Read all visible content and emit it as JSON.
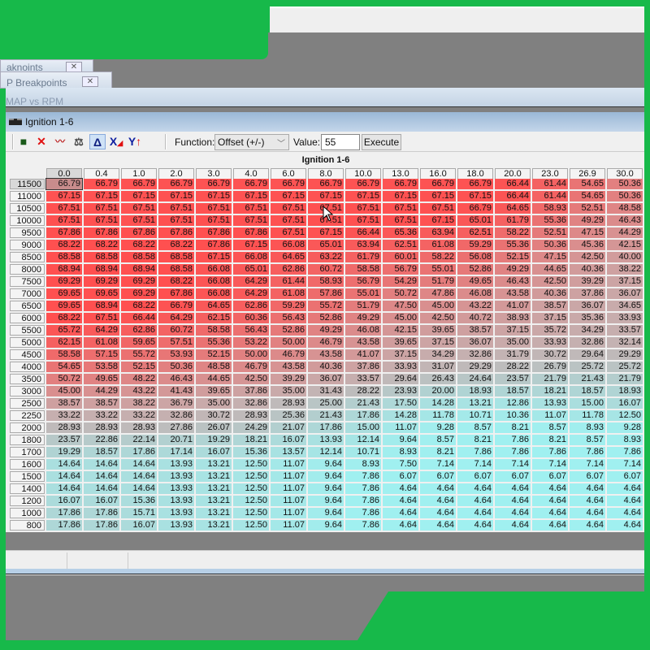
{
  "tabs": [
    {
      "label": "aknoints"
    },
    {
      "label": "P Breakpoints"
    }
  ],
  "map_window": {
    "title": "MAP vs RPM"
  },
  "window": {
    "title": "Ignition 1-6"
  },
  "toolbar": {
    "icons": [
      "save-icon",
      "delete-icon",
      "graph-icon",
      "balance-icon",
      "delta-icon",
      "x-axis-icon",
      "y-axis-icon"
    ],
    "function_label": "Function:",
    "function_value": "Offset (+/-)",
    "value_label": "Value:",
    "value": "55",
    "execute_label": "Execute"
  },
  "table": {
    "title": "Ignition 1-6",
    "columns": [
      "0.0",
      "0.4",
      "1.0",
      "2.0",
      "3.0",
      "4.0",
      "6.0",
      "8.0",
      "10.0",
      "13.0",
      "16.0",
      "18.0",
      "20.0",
      "23.0",
      "26.9",
      "30.0"
    ],
    "selected_cell": {
      "row": "11500",
      "column": "0.0"
    },
    "rows": [
      {
        "rpm": "11500",
        "values": [
          "66.79",
          "66.79",
          "66.79",
          "66.79",
          "66.79",
          "66.79",
          "66.79",
          "66.79",
          "66.79",
          "66.79",
          "66.79",
          "66.79",
          "66.44",
          "61.44",
          "54.65",
          "50.36"
        ]
      },
      {
        "rpm": "11000",
        "values": [
          "67.15",
          "67.15",
          "67.15",
          "67.15",
          "67.15",
          "67.15",
          "67.15",
          "67.15",
          "67.15",
          "67.15",
          "67.15",
          "67.15",
          "66.44",
          "61.44",
          "54.65",
          "50.36"
        ]
      },
      {
        "rpm": "10500",
        "values": [
          "67.51",
          "67.51",
          "67.51",
          "67.51",
          "67.51",
          "67.51",
          "67.51",
          "67.51",
          "67.51",
          "67.51",
          "67.51",
          "66.79",
          "64.65",
          "58.93",
          "52.51",
          "48.58"
        ]
      },
      {
        "rpm": "10000",
        "values": [
          "67.51",
          "67.51",
          "67.51",
          "67.51",
          "67.51",
          "67.51",
          "67.51",
          "67.51",
          "67.51",
          "67.51",
          "67.15",
          "65.01",
          "61.79",
          "55.36",
          "49.29",
          "46.43"
        ]
      },
      {
        "rpm": "9500",
        "values": [
          "67.86",
          "67.86",
          "67.86",
          "67.86",
          "67.86",
          "67.86",
          "67.51",
          "67.15",
          "66.44",
          "65.36",
          "63.94",
          "62.51",
          "58.22",
          "52.51",
          "47.15",
          "44.29"
        ]
      },
      {
        "rpm": "9000",
        "values": [
          "68.22",
          "68.22",
          "68.22",
          "68.22",
          "67.86",
          "67.15",
          "66.08",
          "65.01",
          "63.94",
          "62.51",
          "61.08",
          "59.29",
          "55.36",
          "50.36",
          "45.36",
          "42.15"
        ]
      },
      {
        "rpm": "8500",
        "values": [
          "68.58",
          "68.58",
          "68.58",
          "68.58",
          "67.15",
          "66.08",
          "64.65",
          "63.22",
          "61.79",
          "60.01",
          "58.22",
          "56.08",
          "52.15",
          "47.15",
          "42.50",
          "40.00"
        ]
      },
      {
        "rpm": "8000",
        "values": [
          "68.94",
          "68.94",
          "68.94",
          "68.58",
          "66.08",
          "65.01",
          "62.86",
          "60.72",
          "58.58",
          "56.79",
          "55.01",
          "52.86",
          "49.29",
          "44.65",
          "40.36",
          "38.22"
        ]
      },
      {
        "rpm": "7500",
        "values": [
          "69.29",
          "69.29",
          "69.29",
          "68.22",
          "66.08",
          "64.29",
          "61.44",
          "58.93",
          "56.79",
          "54.29",
          "51.79",
          "49.65",
          "46.43",
          "42.50",
          "39.29",
          "37.15"
        ]
      },
      {
        "rpm": "7000",
        "values": [
          "69.65",
          "69.65",
          "69.29",
          "67.86",
          "66.08",
          "64.29",
          "61.08",
          "57.86",
          "55.01",
          "50.72",
          "47.86",
          "46.08",
          "43.58",
          "40.36",
          "37.86",
          "36.07"
        ]
      },
      {
        "rpm": "6500",
        "values": [
          "69.65",
          "68.94",
          "68.22",
          "66.79",
          "64.65",
          "62.86",
          "59.29",
          "55.72",
          "51.79",
          "47.50",
          "45.00",
          "43.22",
          "41.07",
          "38.57",
          "36.07",
          "34.65"
        ]
      },
      {
        "rpm": "6000",
        "values": [
          "68.22",
          "67.51",
          "66.44",
          "64.29",
          "62.15",
          "60.36",
          "56.43",
          "52.86",
          "49.29",
          "45.00",
          "42.50",
          "40.72",
          "38.93",
          "37.15",
          "35.36",
          "33.93"
        ]
      },
      {
        "rpm": "5500",
        "values": [
          "65.72",
          "64.29",
          "62.86",
          "60.72",
          "58.58",
          "56.43",
          "52.86",
          "49.29",
          "46.08",
          "42.15",
          "39.65",
          "38.57",
          "37.15",
          "35.72",
          "34.29",
          "33.57"
        ]
      },
      {
        "rpm": "5000",
        "values": [
          "62.15",
          "61.08",
          "59.65",
          "57.51",
          "55.36",
          "53.22",
          "50.00",
          "46.79",
          "43.58",
          "39.65",
          "37.15",
          "36.07",
          "35.00",
          "33.93",
          "32.86",
          "32.14"
        ]
      },
      {
        "rpm": "4500",
        "values": [
          "58.58",
          "57.15",
          "55.72",
          "53.93",
          "52.15",
          "50.00",
          "46.79",
          "43.58",
          "41.07",
          "37.15",
          "34.29",
          "32.86",
          "31.79",
          "30.72",
          "29.64",
          "29.29"
        ]
      },
      {
        "rpm": "4000",
        "values": [
          "54.65",
          "53.58",
          "52.15",
          "50.36",
          "48.58",
          "46.79",
          "43.58",
          "40.36",
          "37.86",
          "33.93",
          "31.07",
          "29.29",
          "28.22",
          "26.79",
          "25.72",
          "25.72"
        ]
      },
      {
        "rpm": "3500",
        "values": [
          "50.72",
          "49.65",
          "48.22",
          "46.43",
          "44.65",
          "42.50",
          "39.29",
          "36.07",
          "33.57",
          "29.64",
          "26.43",
          "24.64",
          "23.57",
          "21.79",
          "21.43",
          "21.79"
        ]
      },
      {
        "rpm": "3000",
        "values": [
          "45.00",
          "44.29",
          "43.22",
          "41.43",
          "39.65",
          "37.86",
          "35.00",
          "31.43",
          "28.22",
          "23.93",
          "20.00",
          "18.93",
          "18.57",
          "18.21",
          "18.57",
          "18.93"
        ]
      },
      {
        "rpm": "2500",
        "values": [
          "38.57",
          "38.57",
          "38.22",
          "36.79",
          "35.00",
          "32.86",
          "28.93",
          "25.00",
          "21.43",
          "17.50",
          "14.28",
          "13.21",
          "12.86",
          "13.93",
          "15.00",
          "16.07"
        ]
      },
      {
        "rpm": "2250",
        "values": [
          "33.22",
          "33.22",
          "33.22",
          "32.86",
          "30.72",
          "28.93",
          "25.36",
          "21.43",
          "17.86",
          "14.28",
          "11.78",
          "10.71",
          "10.36",
          "11.07",
          "11.78",
          "12.50"
        ]
      },
      {
        "rpm": "2000",
        "values": [
          "28.93",
          "28.93",
          "28.93",
          "27.86",
          "26.07",
          "24.29",
          "21.07",
          "17.86",
          "15.00",
          "11.07",
          "9.28",
          "8.57",
          "8.21",
          "8.57",
          "8.93",
          "9.28"
        ]
      },
      {
        "rpm": "1800",
        "values": [
          "23.57",
          "22.86",
          "22.14",
          "20.71",
          "19.29",
          "18.21",
          "16.07",
          "13.93",
          "12.14",
          "9.64",
          "8.57",
          "8.21",
          "7.86",
          "8.21",
          "8.57",
          "8.93"
        ]
      },
      {
        "rpm": "1700",
        "values": [
          "19.29",
          "18.57",
          "17.86",
          "17.14",
          "16.07",
          "15.36",
          "13.57",
          "12.14",
          "10.71",
          "8.93",
          "8.21",
          "7.86",
          "7.86",
          "7.86",
          "7.86",
          "7.86"
        ]
      },
      {
        "rpm": "1600",
        "values": [
          "14.64",
          "14.64",
          "14.64",
          "13.93",
          "13.21",
          "12.50",
          "11.07",
          "9.64",
          "8.93",
          "7.50",
          "7.14",
          "7.14",
          "7.14",
          "7.14",
          "7.14",
          "7.14"
        ]
      },
      {
        "rpm": "1500",
        "values": [
          "14.64",
          "14.64",
          "14.64",
          "13.93",
          "13.21",
          "12.50",
          "11.07",
          "9.64",
          "7.86",
          "6.07",
          "6.07",
          "6.07",
          "6.07",
          "6.07",
          "6.07",
          "6.07"
        ]
      },
      {
        "rpm": "1400",
        "values": [
          "14.64",
          "14.64",
          "14.64",
          "13.93",
          "13.21",
          "12.50",
          "11.07",
          "9.64",
          "7.86",
          "4.64",
          "4.64",
          "4.64",
          "4.64",
          "4.64",
          "4.64",
          "4.64"
        ]
      },
      {
        "rpm": "1200",
        "values": [
          "16.07",
          "16.07",
          "15.36",
          "13.93",
          "13.21",
          "12.50",
          "11.07",
          "9.64",
          "7.86",
          "4.64",
          "4.64",
          "4.64",
          "4.64",
          "4.64",
          "4.64",
          "4.64"
        ]
      },
      {
        "rpm": "1000",
        "values": [
          "17.86",
          "17.86",
          "15.71",
          "13.93",
          "13.21",
          "12.50",
          "11.07",
          "9.64",
          "7.86",
          "4.64",
          "4.64",
          "4.64",
          "4.64",
          "4.64",
          "4.64",
          "4.64"
        ]
      },
      {
        "rpm": "800",
        "values": [
          "17.86",
          "17.86",
          "16.07",
          "13.93",
          "13.21",
          "12.50",
          "11.07",
          "9.64",
          "7.86",
          "4.64",
          "4.64",
          "4.64",
          "4.64",
          "4.64",
          "4.64",
          "4.64"
        ]
      }
    ]
  },
  "colors": {
    "high": "#ff5050",
    "mid": "#bdbdbd",
    "low": "#a0f0f0",
    "background": "#17b94a"
  }
}
